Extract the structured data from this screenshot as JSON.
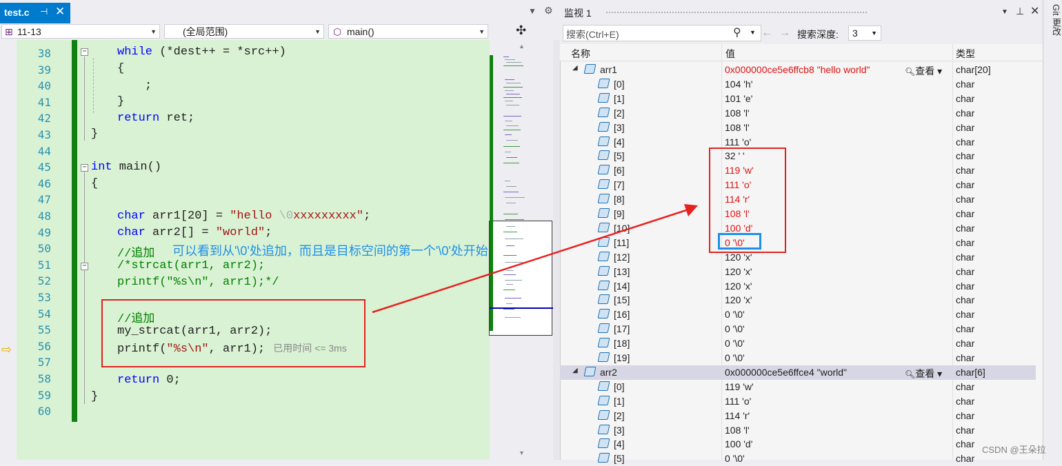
{
  "editor": {
    "tab_name": "test.c",
    "tab_pin": "⊣",
    "tab_close": "✕",
    "nav": {
      "project": "11-13",
      "scope": "(全局范围)",
      "function": "main()"
    },
    "lines": [
      {
        "n": "38"
      },
      {
        "n": "39"
      },
      {
        "n": "40"
      },
      {
        "n": "41"
      },
      {
        "n": "42"
      },
      {
        "n": "43"
      },
      {
        "n": "44"
      },
      {
        "n": "45"
      },
      {
        "n": "46"
      },
      {
        "n": "47"
      },
      {
        "n": "48"
      },
      {
        "n": "49"
      },
      {
        "n": "50"
      },
      {
        "n": "51"
      },
      {
        "n": "52"
      },
      {
        "n": "53"
      },
      {
        "n": "54"
      },
      {
        "n": "55"
      },
      {
        "n": "56"
      },
      {
        "n": "57"
      },
      {
        "n": "58"
      },
      {
        "n": "59"
      },
      {
        "n": "60"
      }
    ],
    "code": {
      "l38_kw": "while",
      "l38_rest": " (*dest++ = *src++)",
      "l39": "{",
      "l40": ";",
      "l41": "}",
      "l42_kw": "return",
      "l42_rest": " ret;",
      "l43": "}",
      "l45_kw": "int",
      "l45_rest": " main()",
      "l46": "{",
      "l48_kw": "char",
      "l48_a": " arr1[20] = ",
      "l48_s1": "\"hello ",
      "l48_esc": "\\0",
      "l48_s2": "xxxxxxxxx\"",
      "l48_end": ";",
      "l49_kw": "char",
      "l49_a": " arr2[] = ",
      "l49_s": "\"world\"",
      "l49_end": ";",
      "l50": "//追加",
      "l51": "/*strcat(arr1, arr2);",
      "l52": "printf(\"%s\\n\", arr1);*/",
      "l54": "//追加",
      "l55": "my_strcat(arr1, arr2);",
      "l56_a": "printf(",
      "l56_s": "\"%s\\n\"",
      "l56_b": ", arr1);",
      "l56_hint": "已用时间 <= 3ms",
      "l58_kw": "return",
      "l58_rest": " 0;",
      "l59": "}"
    },
    "annotation": "可以看到从'\\0'处追加，而且是目标空间的第一个'\\0'处开始"
  },
  "watch": {
    "title": "监视 1",
    "search_placeholder": "搜索(Ctrl+E)",
    "search_depth_label": "搜索深度:",
    "search_depth_value": "3",
    "columns": {
      "name": "名称",
      "value": "值",
      "type": "类型"
    },
    "view_label": "查看",
    "rows": [
      {
        "name": "arr1",
        "value": "0x000000ce5e6ffcb8 \"hello world\"",
        "type": "char[20]",
        "top": true,
        "red": true,
        "expand": "◢"
      },
      {
        "name": "[0]",
        "value": "104 'h'",
        "type": "char"
      },
      {
        "name": "[1]",
        "value": "101 'e'",
        "type": "char"
      },
      {
        "name": "[2]",
        "value": "108 'l'",
        "type": "char"
      },
      {
        "name": "[3]",
        "value": "108 'l'",
        "type": "char"
      },
      {
        "name": "[4]",
        "value": "111 'o'",
        "type": "char"
      },
      {
        "name": "[5]",
        "value": "32 ' '",
        "type": "char"
      },
      {
        "name": "[6]",
        "value": "119 'w'",
        "type": "char",
        "red": true
      },
      {
        "name": "[7]",
        "value": "111 'o'",
        "type": "char",
        "red": true
      },
      {
        "name": "[8]",
        "value": "114 'r'",
        "type": "char",
        "red": true
      },
      {
        "name": "[9]",
        "value": "108 'l'",
        "type": "char",
        "red": true
      },
      {
        "name": "[10]",
        "value": "100 'd'",
        "type": "char",
        "red": true
      },
      {
        "name": "[11]",
        "value": "0 '\\0'",
        "type": "char",
        "red": true
      },
      {
        "name": "[12]",
        "value": "120 'x'",
        "type": "char"
      },
      {
        "name": "[13]",
        "value": "120 'x'",
        "type": "char"
      },
      {
        "name": "[14]",
        "value": "120 'x'",
        "type": "char"
      },
      {
        "name": "[15]",
        "value": "120 'x'",
        "type": "char"
      },
      {
        "name": "[16]",
        "value": "0 '\\0'",
        "type": "char"
      },
      {
        "name": "[17]",
        "value": "0 '\\0'",
        "type": "char"
      },
      {
        "name": "[18]",
        "value": "0 '\\0'",
        "type": "char"
      },
      {
        "name": "[19]",
        "value": "0 '\\0'",
        "type": "char"
      },
      {
        "name": "arr2",
        "value": "0x000000ce5e6ffce4 \"world\"",
        "type": "char[6]",
        "top": true,
        "selected": true,
        "expand": "◢"
      },
      {
        "name": "[0]",
        "value": "119 'w'",
        "type": "char"
      },
      {
        "name": "[1]",
        "value": "111 'o'",
        "type": "char"
      },
      {
        "name": "[2]",
        "value": "114 'r'",
        "type": "char"
      },
      {
        "name": "[3]",
        "value": "108 'l'",
        "type": "char"
      },
      {
        "name": "[4]",
        "value": "100 'd'",
        "type": "char"
      },
      {
        "name": "[5]",
        "value": "0 '\\0'",
        "type": "char"
      }
    ]
  },
  "side_tab": "Git 更改",
  "watermark": "CSDN @王朵拉",
  "colors": {
    "accent": "#007acc",
    "changed": "#e01010",
    "annotation": "#1e90e8",
    "code_bg": "#d9f2d4"
  }
}
